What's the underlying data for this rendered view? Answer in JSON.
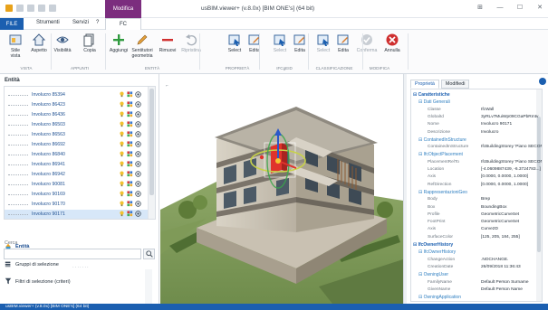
{
  "app": {
    "window_title": "usBIM.viewer+ (v.8.0x) [BIM ONE's] (64 bit)",
    "context_tab": "Modifica"
  },
  "menu": {
    "file": "FILE",
    "tabs": [
      "Strumenti",
      "Servizi",
      "?"
    ],
    "active_tab": "FC"
  },
  "ribbon": {
    "buttons": [
      {
        "label": "Stile\nvista",
        "icon": "style-view-icon"
      },
      {
        "label": "Aspetto",
        "icon": "home-icon"
      },
      {
        "label": "Visibilità",
        "icon": "visibility-icon"
      },
      {
        "label": "Copia",
        "icon": "copy-icon"
      },
      {
        "label": "Aggiungi",
        "icon": "add-icon"
      },
      {
        "label": "Sentitutori\ngeometria",
        "icon": "pencil-icon"
      },
      {
        "label": "Rimuovi",
        "icon": "remove-icon"
      },
      {
        "label": "Ripristina",
        "icon": "undo-icon"
      },
      {
        "label": "Select",
        "icon": "select-icon"
      },
      {
        "label": "Edita",
        "icon": "edit-icon"
      },
      {
        "label": "Select",
        "icon": "select-icon"
      },
      {
        "label": "Edita",
        "icon": "edit-icon"
      },
      {
        "label": "Select",
        "icon": "select-icon"
      },
      {
        "label": "Edita",
        "icon": "edit-icon"
      },
      {
        "label": "Conferma",
        "icon": "confirm-icon"
      },
      {
        "label": "Annulla",
        "icon": "cancel-icon"
      }
    ],
    "groups": [
      "VISTA",
      "APPUNTI",
      "ENTITÀ",
      "PROPRIETÀ",
      "IFCgEID",
      "CLASSIFICAZIONE",
      "MODIFICA"
    ]
  },
  "left": {
    "title": "Entità",
    "tree_items": [
      "Involucro 85394",
      "Involucro 86423",
      "Involucro 86436",
      "Involucro 86503",
      "Involucro 86563",
      "Involucro 86692",
      "Involucro 86840",
      "Involucro 86941",
      "Involucro 86942",
      "Involucro 90081",
      "Involucro 90169",
      "Involucro 90170",
      "Involucro 90171"
    ],
    "selected_index": 12,
    "search_label": "Cerca",
    "search_value": "",
    "links": [
      {
        "label": "Entità",
        "icon": "entity-icon",
        "bold": true
      },
      {
        "label": "Gruppi di selezione",
        "icon": "groups-icon",
        "bold": false
      },
      {
        "label": "Filtri di selezione (criteri)",
        "icon": "filter-icon",
        "bold": false
      }
    ]
  },
  "right": {
    "tabs": [
      "Proprietà",
      "Modifiedi"
    ],
    "active_tab": 0,
    "rows": [
      {
        "kind": "sec",
        "label": "⊟ Caratteristiche"
      },
      {
        "kind": "sub",
        "label": "⊟ Dati Generali"
      },
      {
        "kind": "kv",
        "key": "Classe",
        "value": "IfcWall"
      },
      {
        "kind": "kv",
        "key": "GlobalId",
        "value": "3yRLv7MuiWp09CGaPbRmtv"
      },
      {
        "kind": "kv",
        "key": "Nome",
        "value": "Involucro 90171"
      },
      {
        "kind": "kv",
        "key": "Descrizione",
        "value": "Involucro"
      },
      {
        "kind": "sub",
        "label": "⊟ ContainedInStructure"
      },
      {
        "kind": "kv",
        "key": "ContainedInStructure",
        "value": "IfcBuildingStorey 'Piano SECONDO'"
      },
      {
        "kind": "sub",
        "label": "⊟ IfcObjectPlacement"
      },
      {
        "kind": "kv",
        "key": "PlacementRelTo",
        "value": "IfcBuildingStorey 'Piano SECONDO'"
      },
      {
        "kind": "kv",
        "key": "Location",
        "value": "[-4.0609887439, -6.3724783...]"
      },
      {
        "kind": "kv",
        "key": "Axis",
        "value": "[0.0000, 0.0000, 1.0000]"
      },
      {
        "kind": "kv",
        "key": "RefDirection",
        "value": "[0.0000, 0.0000, 1.0000]"
      },
      {
        "kind": "sub",
        "label": "⊟ RappresentazioniGeo"
      },
      {
        "kind": "kv",
        "key": "Body",
        "value": "Brep"
      },
      {
        "kind": "kv",
        "key": "Box",
        "value": "BoundingBox"
      },
      {
        "kind": "kv",
        "key": "Profile",
        "value": "GeometricCurveSet"
      },
      {
        "kind": "kv",
        "key": "FootPrint",
        "value": "GeometricCurveSet"
      },
      {
        "kind": "kv",
        "key": "Axis",
        "value": "Curve2D"
      },
      {
        "kind": "kv",
        "key": "SurfaceColor",
        "value": "[125, 205, 184, 255]"
      },
      {
        "kind": "sec",
        "label": "⊟ IfcOwnerHistory"
      },
      {
        "kind": "sub",
        "label": "⊟ IfcOwnerHistory"
      },
      {
        "kind": "kv",
        "key": "ChangeAction",
        "value": ".NOCHANGE."
      },
      {
        "kind": "kv",
        "key": "CreationDate",
        "value": "26/09/2018 11:36:43"
      },
      {
        "kind": "sub",
        "label": "⊟ OwningUser"
      },
      {
        "kind": "kv",
        "key": "FamilyName",
        "value": "Default Person Surname"
      },
      {
        "kind": "kv",
        "key": "GivenName",
        "value": "Default Person Name"
      },
      {
        "kind": "sub",
        "label": "⊟ OwningApplication"
      }
    ]
  },
  "status": {
    "text": "usBIM.viewer+ (v.8.0x) [BIM ONE's] (64 bit)"
  },
  "colors": {
    "accent": "#1b5fb0",
    "context": "#7b2d7e",
    "tree_text": "#1d4f91"
  }
}
